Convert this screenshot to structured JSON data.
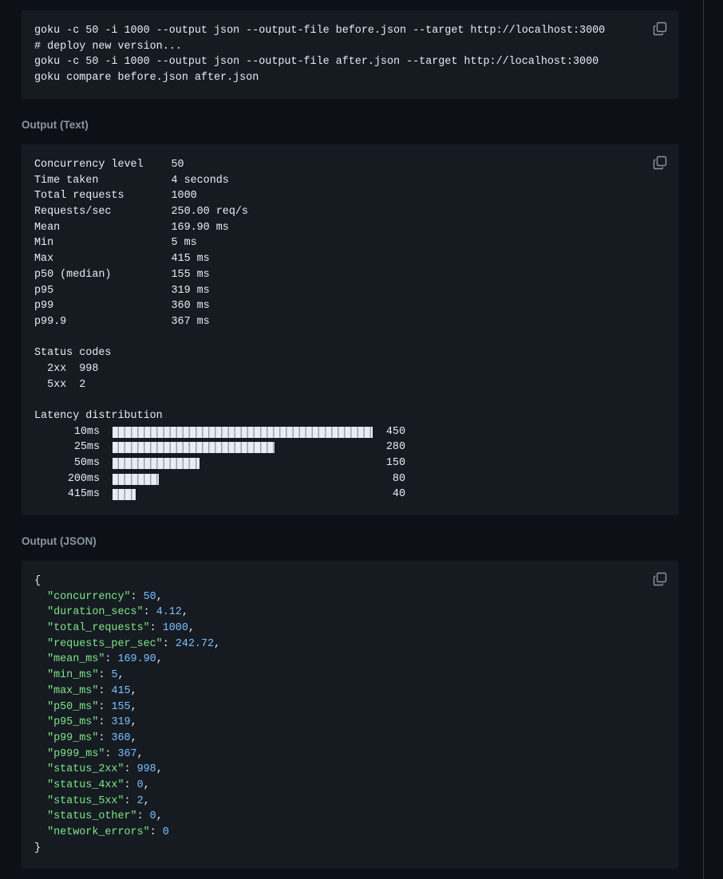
{
  "commands_block": {
    "lines": [
      "goku -c 50 -i 1000 --output json --output-file before.json --target http://localhost:3000",
      "# deploy new version...",
      "goku -c 50 -i 1000 --output json --output-file after.json --target http://localhost:3000",
      "goku compare before.json after.json"
    ],
    "copy_icon": "copy-icon"
  },
  "text_output": {
    "heading": "Output (Text)",
    "stats": [
      {
        "key": "Concurrency level",
        "value": "50"
      },
      {
        "key": "Time taken",
        "value": "4 seconds"
      },
      {
        "key": "Total requests",
        "value": "1000"
      },
      {
        "key": "Requests/sec",
        "value": "250.00 req/s"
      },
      {
        "key": "Mean",
        "value": "169.90 ms"
      },
      {
        "key": "Min",
        "value": "5 ms"
      },
      {
        "key": "Max",
        "value": "415 ms"
      },
      {
        "key": "p50 (median)",
        "value": "155 ms"
      },
      {
        "key": "p95",
        "value": "319 ms"
      },
      {
        "key": "p99",
        "value": "360 ms"
      },
      {
        "key": "p99.9",
        "value": "367 ms"
      }
    ],
    "status_heading": "Status codes",
    "status_codes": [
      {
        "code": "2xx",
        "count": "998"
      },
      {
        "code": "5xx",
        "count": "2"
      }
    ],
    "latency_heading": "Latency distribution",
    "latency": [
      {
        "label": "10ms",
        "count": 450
      },
      {
        "label": "25ms",
        "count": 280
      },
      {
        "label": "50ms",
        "count": 150
      },
      {
        "label": "200ms",
        "count": 80
      },
      {
        "label": "415ms",
        "count": 40
      }
    ],
    "latency_max": 450
  },
  "json_output": {
    "heading": "Output (JSON)",
    "open": "{",
    "close": "}",
    "fields": [
      {
        "key": "\"concurrency\"",
        "value": "50"
      },
      {
        "key": "\"duration_secs\"",
        "value": "4.12"
      },
      {
        "key": "\"total_requests\"",
        "value": "1000"
      },
      {
        "key": "\"requests_per_sec\"",
        "value": "242.72"
      },
      {
        "key": "\"mean_ms\"",
        "value": "169.90"
      },
      {
        "key": "\"min_ms\"",
        "value": "5"
      },
      {
        "key": "\"max_ms\"",
        "value": "415"
      },
      {
        "key": "\"p50_ms\"",
        "value": "155"
      },
      {
        "key": "\"p95_ms\"",
        "value": "319"
      },
      {
        "key": "\"p99_ms\"",
        "value": "360"
      },
      {
        "key": "\"p999_ms\"",
        "value": "367"
      },
      {
        "key": "\"status_2xx\"",
        "value": "998"
      },
      {
        "key": "\"status_4xx\"",
        "value": "0"
      },
      {
        "key": "\"status_5xx\"",
        "value": "2"
      },
      {
        "key": "\"status_other\"",
        "value": "0"
      },
      {
        "key": "\"network_errors\"",
        "value": "0"
      }
    ]
  },
  "colors": {
    "page_bg": "#0d1117",
    "block_bg": "#161b22",
    "json_key": "#7ee787",
    "json_number": "#79c0ff",
    "label": "#8b949e"
  }
}
